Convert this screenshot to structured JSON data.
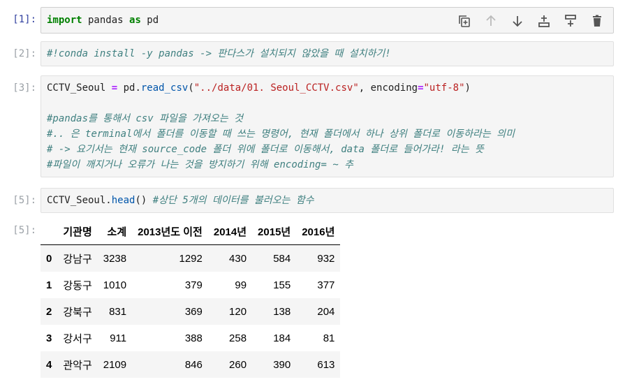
{
  "cells": [
    {
      "prompt": "[1]:",
      "code_parts": [
        "import",
        " pandas ",
        "as",
        " pd"
      ]
    },
    {
      "prompt": "[2]:",
      "code": "#!conda install -y pandas -> 판다스가 설치되지 않았을 때 설치하기!"
    },
    {
      "prompt": "[3]:",
      "line1": [
        "CCTV_Seoul ",
        "=",
        " pd.",
        "read_csv",
        "(",
        "\"../data/01. Seoul_CCTV.csv\"",
        ", encoding",
        "=",
        "\"utf-8\"",
        ")"
      ],
      "comments": [
        "#pandas를 통해서 csv 파일을 가져오는 것",
        "#.. 은 terminal에서 폴더를 이동할 때 쓰는 명령어, 현재 폴더에서 하나 상위 폴더로 이동하라는 의미",
        "# -> 요기서는 현재 source_code 폴더 위에 폴더로 이동해서, data 폴더로 들어가라! 라는 뜻",
        "#파일이 깨지거나 오류가 나는 것을 방지하기 위해 encoding= ~ 추"
      ]
    },
    {
      "prompt": "[5]:",
      "code_parts": [
        "CCTV_Seoul.",
        "head",
        "() ",
        "#상단 5개의 데이터를 불러오는 함수"
      ]
    }
  ],
  "output": {
    "prompt": "[5]:",
    "columns": [
      "",
      "기관명",
      "소계",
      "2013년도 이전",
      "2014년",
      "2015년",
      "2016년"
    ],
    "rows": [
      [
        "0",
        "강남구",
        "3238",
        "1292",
        "430",
        "584",
        "932"
      ],
      [
        "1",
        "강동구",
        "1010",
        "379",
        "99",
        "155",
        "377"
      ],
      [
        "2",
        "강북구",
        "831",
        "369",
        "120",
        "138",
        "204"
      ],
      [
        "3",
        "강서구",
        "911",
        "388",
        "258",
        "184",
        "81"
      ],
      [
        "4",
        "관악구",
        "2109",
        "846",
        "260",
        "390",
        "613"
      ]
    ]
  },
  "toolbar": {
    "icons": [
      "copy-icon",
      "move-up-icon",
      "move-down-icon",
      "insert-above-icon",
      "insert-below-icon",
      "delete-icon"
    ]
  }
}
